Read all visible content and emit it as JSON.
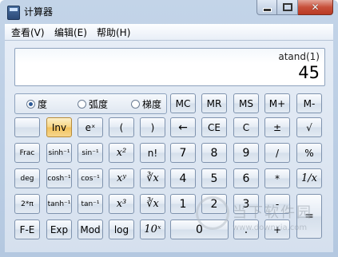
{
  "window": {
    "title": "计算器"
  },
  "menu": [
    "查看(V)",
    "编辑(E)",
    "帮助(H)"
  ],
  "display": {
    "expression": "atand(1)",
    "value": "45"
  },
  "angle_mode": {
    "options": [
      "度",
      "弧度",
      "梯度"
    ],
    "selected": "度"
  },
  "memory_buttons": [
    "MC",
    "MR",
    "MS",
    "M+",
    "M-"
  ],
  "rows": [
    [
      "",
      "Inv",
      "eˣ",
      "(",
      ")",
      "←",
      "CE",
      "C",
      "±",
      "√"
    ],
    [
      "Frac",
      "sinh⁻¹",
      "sin⁻¹",
      "x²",
      "n!",
      "7",
      "8",
      "9",
      "/",
      "%"
    ],
    [
      "deg",
      "cosh⁻¹",
      "cos⁻¹",
      "xʸ",
      "∛x",
      "4",
      "5",
      "6",
      "*",
      "1/x"
    ],
    [
      "2*π",
      "tanh⁻¹",
      "tan⁻¹",
      "x³",
      "∛x",
      "1",
      "2",
      "3",
      "-",
      "="
    ],
    [
      "F-E",
      "Exp",
      "Mod",
      "log",
      "10ˣ",
      "0",
      ".",
      "+"
    ]
  ],
  "watermark": {
    "text": "当下软件园",
    "url": "www.downxia.com"
  },
  "colors": {
    "inv_button": "#f6cf75",
    "window_frame": "#bcd0e6"
  },
  "icons": {
    "minimize": "minimize-icon",
    "maximize": "maximize-icon",
    "close": "close-icon"
  }
}
